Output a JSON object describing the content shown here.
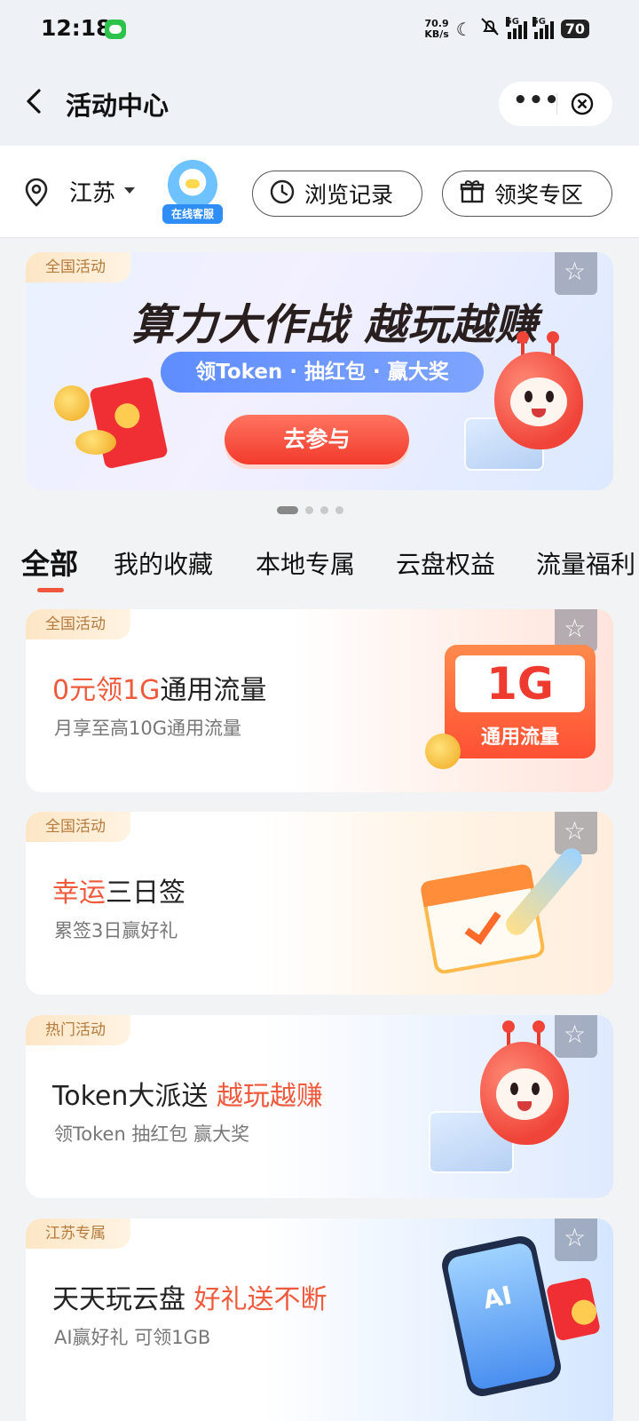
{
  "status_bar": {
    "time": "12:18",
    "speed_value": "70.9",
    "speed_unit": "KB/s",
    "network_1": "5G",
    "network_2": "5G",
    "battery": "70"
  },
  "header": {
    "title": "活动中心",
    "back_icon": "chevron-left-icon",
    "more_icon": "more-icon",
    "close_icon": "close-circle-icon"
  },
  "filter": {
    "province": "江苏",
    "customer_service_label": "在线客服",
    "history_label": "浏览记录",
    "reward_label": "领奖专区"
  },
  "banner": {
    "tag": "全国活动",
    "title": "算力大作战 越玩越赚",
    "subtitle": "领Token · 抽红包 · 赢大奖",
    "cta": "去参与"
  },
  "carousel": {
    "count": 4,
    "active_index": 0
  },
  "tabs": [
    {
      "label": "全部",
      "active": true
    },
    {
      "label": "我的收藏",
      "active": false
    },
    {
      "label": "本地专属",
      "active": false
    },
    {
      "label": "云盘权益",
      "active": false
    },
    {
      "label": "流量福利",
      "active": false
    }
  ],
  "cards": [
    {
      "tag": "全国活动",
      "title_highlight": "0元领1G",
      "title_rest": "通用流量",
      "desc": "月享至高10G通用流量",
      "art_big": "1G",
      "art_label": "通用流量"
    },
    {
      "tag": "全国活动",
      "title_highlight": "幸运",
      "title_rest": "三日签",
      "desc": "累签3日赢好礼"
    },
    {
      "tag": "热门活动",
      "title_plain": "Token大派送 ",
      "title_highlight": "越玩越赚",
      "desc": "领Token  抽红包  赢大奖"
    },
    {
      "tag": "江苏专属",
      "title_plain": "天天玩云盘 ",
      "title_highlight": "好礼送不断",
      "desc": "AI赢好礼  可领1GB"
    }
  ],
  "colors": {
    "accent": "#f0563c",
    "tag_text": "#b67a3c",
    "page_bg": "#f2f3f5"
  }
}
